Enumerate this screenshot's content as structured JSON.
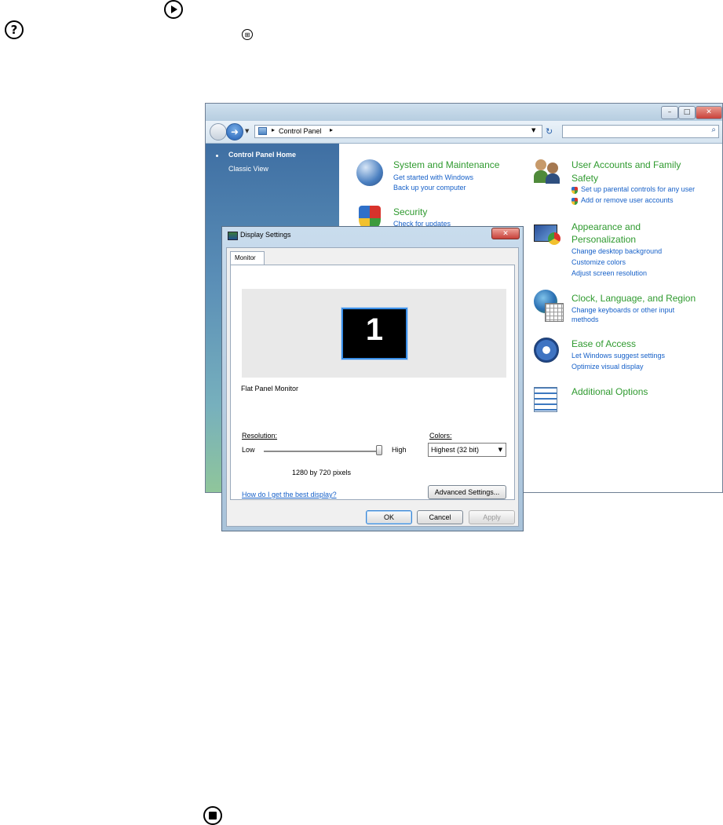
{
  "control_panel": {
    "breadcrumb": "Control Panel",
    "sidebar": {
      "home": "Control Panel Home",
      "classic": "Classic View"
    },
    "categories": {
      "system": {
        "title": "System and Maintenance",
        "links": [
          "Get started with Windows",
          "Back up your computer"
        ]
      },
      "security": {
        "title": "Security",
        "links": [
          "Check for updates"
        ]
      },
      "user_accounts": {
        "title_line1": "User Accounts and Family",
        "title_line2": "Safety",
        "links": [
          "Set up parental controls for any user",
          "Add or remove user accounts"
        ]
      },
      "appearance": {
        "title_line1": "Appearance and",
        "title_line2": "Personalization",
        "links": [
          "Change desktop background",
          "Customize colors",
          "Adjust screen resolution"
        ]
      },
      "clock": {
        "title": "Clock, Language, and Region",
        "links": [
          "Change keyboards or other input",
          "methods"
        ]
      },
      "ease": {
        "title": "Ease of Access",
        "links": [
          "Let Windows suggest settings",
          "Optimize visual display"
        ]
      },
      "additional": {
        "title": "Additional Options"
      }
    }
  },
  "dialog": {
    "title": "Display Settings",
    "tab": "Monitor",
    "monitor_number": "1",
    "monitor_name": "Flat Panel Monitor",
    "resolution_label": "Resolution:",
    "low": "Low",
    "high": "High",
    "resolution_value": "1280 by 720 pixels",
    "slider_level": 1.0,
    "colors_label": "Colors:",
    "colors_value": "Highest (32 bit)",
    "help_link": "How do I get the best display?",
    "advanced_button": "Advanced Settings...",
    "ok_button": "OK",
    "cancel_button": "Cancel",
    "apply_button": "Apply"
  },
  "colors": {
    "category_green": "#2f9a2f",
    "link_blue": "#1660c8",
    "close_red": "#c8413a"
  }
}
